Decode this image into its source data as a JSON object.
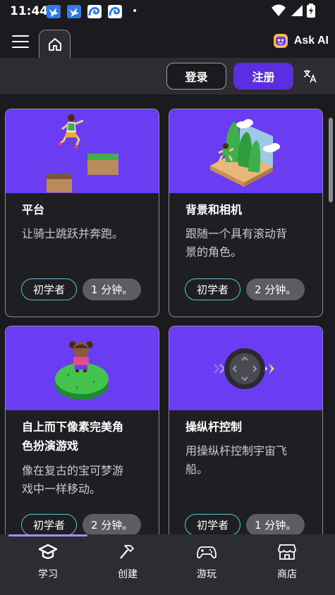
{
  "status_bar": {
    "time": "11:44",
    "icons": [
      "bird-icon",
      "bird-icon",
      "wave-app-icon",
      "wave-app-icon"
    ],
    "dot": "•"
  },
  "header": {
    "ask_ai_label": "Ask AI"
  },
  "auth": {
    "login_label": "登录",
    "register_label": "注册"
  },
  "cards": [
    {
      "title": "平台",
      "description_lines": [
        "让骑士跳跃并奔跑。"
      ],
      "level": "初学者",
      "duration": "1 分钟。"
    },
    {
      "title": "背景和相机",
      "description_lines": [
        "跟随一个具有滚动背",
        "景的角色。"
      ],
      "level": "初学者",
      "duration": "2 分钟。"
    },
    {
      "title_lines": [
        "自上而下像素完美角",
        "色扮演游戏"
      ],
      "description_lines": [
        "像在复古的宝可梦游",
        "戏中一样移动。"
      ],
      "level": "初学者",
      "duration": "2 分钟。"
    },
    {
      "title": "操纵杆控制",
      "description_lines": [
        "用操纵杆控制宇宙飞",
        "船。"
      ],
      "level": "初学者",
      "duration": "1 分钟。"
    }
  ],
  "bottom_nav": [
    {
      "label": "学习",
      "icon": "graduation-cap-icon",
      "active": true
    },
    {
      "label": "创建",
      "icon": "hammer-icon",
      "active": false
    },
    {
      "label": "游玩",
      "icon": "gamepad-icon",
      "active": false
    },
    {
      "label": "商店",
      "icon": "store-icon",
      "active": false
    }
  ],
  "colors": {
    "accent": "#5b2fe0",
    "card_image_bg": "#6a3df2",
    "level_border": "#58c8c4",
    "background": "#1b1b1f"
  }
}
